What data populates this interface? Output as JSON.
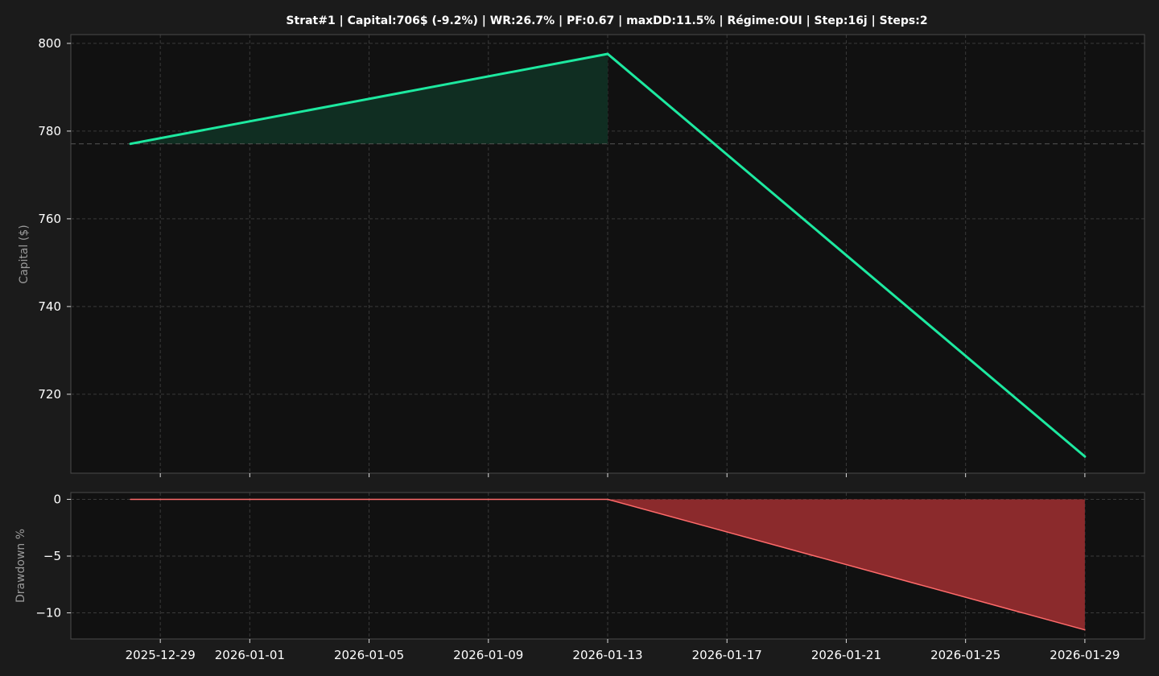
{
  "chart_data": [
    {
      "type": "area",
      "title": "Strat#1 | Capital:706$ (-9.2%) | WR:26.7% | PF:0.67 | maxDD:11.5% | Régime:OUI | Step:16j | Steps:2",
      "xlabel": "",
      "ylabel": "Capital ($)",
      "ylim": [
        702,
        802
      ],
      "yticks": [
        720,
        740,
        760,
        780,
        800
      ],
      "x": [
        "2025-12-28",
        "2026-01-13",
        "2026-01-29"
      ],
      "series": [
        {
          "values": [
            777.1,
            797.6,
            705.8
          ],
          "color": "#1de9a0"
        }
      ],
      "baseline": 777.1,
      "fill_color": "#102e22",
      "grid": true
    },
    {
      "type": "area",
      "xlabel": "",
      "ylabel": "Drawdown %",
      "ylim": [
        -12.3,
        0.6
      ],
      "yticks": [
        -10,
        -5,
        0
      ],
      "yticklabels": [
        "−10",
        "−5",
        "0"
      ],
      "x": [
        "2025-12-28",
        "2026-01-13",
        "2026-01-29"
      ],
      "series": [
        {
          "values": [
            0,
            0,
            -11.5
          ],
          "color": "#ff6b6b"
        }
      ],
      "fill_color": "#8b2a2c",
      "grid": true
    }
  ],
  "x_axis": {
    "xlim": [
      "2025-12-26",
      "2026-01-31"
    ],
    "ticks": [
      "2025-12-29",
      "2026-01-01",
      "2026-01-05",
      "2026-01-09",
      "2026-01-13",
      "2026-01-17",
      "2026-01-21",
      "2026-01-25",
      "2026-01-29"
    ]
  },
  "style": {
    "figure_bg": "#1b1b1b",
    "axes_bg": "#111111",
    "spine_color": "#4a4a4a",
    "grid_color": "#3a3a3a",
    "text_color": "#ffffff",
    "label_color": "#9a9a9a"
  }
}
